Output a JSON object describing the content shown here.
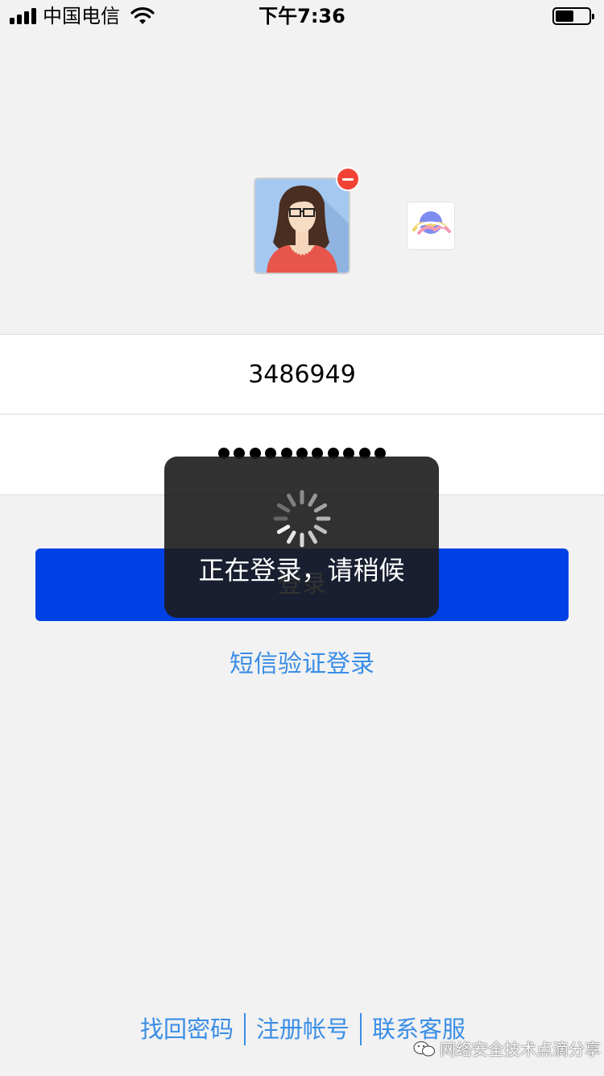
{
  "status_bar": {
    "carrier": "中国电信",
    "time": "下午7:36",
    "battery_level": 0.55
  },
  "accounts": {
    "current_avatar_icon": "woman-with-glasses-avatar",
    "remove_icon": "minus-circle-icon",
    "add_icon": "app-logo-icon"
  },
  "form": {
    "account_value": "3486949",
    "password_mask_length": 11
  },
  "login_button": {
    "label": "登录",
    "color": "#0041e6"
  },
  "sms_login_link": "短信验证登录",
  "loading_hud": {
    "message": "正在登录，请稍候"
  },
  "footer": {
    "links": [
      "找回密码",
      "注册帐号",
      "联系客服"
    ]
  },
  "watermark": {
    "text": "网络安全技术点滴分享"
  },
  "colors": {
    "link": "#3a8ee6",
    "background": "#f2f2f2"
  }
}
